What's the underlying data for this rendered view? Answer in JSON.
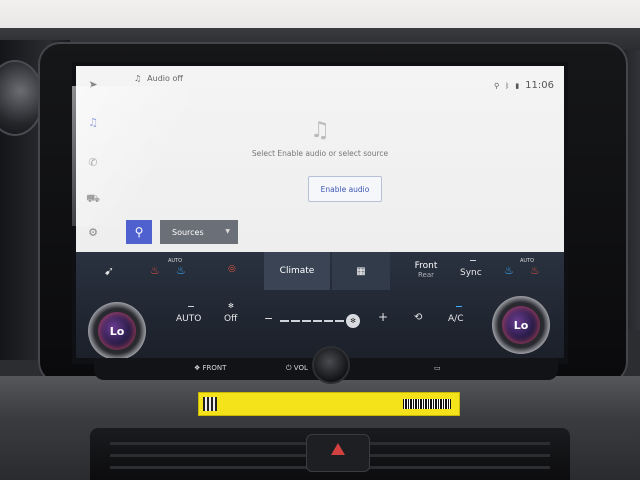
{
  "status": {
    "audio_label": "Audio off",
    "time": "11:06"
  },
  "side_nav": [
    "navigation-icon",
    "music-icon",
    "phone-icon",
    "car-icon",
    "settings-icon"
  ],
  "audio": {
    "message": "Select Enable audio or select source",
    "enable_button": "Enable audio",
    "sources_label": "Sources"
  },
  "climate": {
    "auto_tag_left": "AUTO",
    "auto_tag_right": "AUTO",
    "climate_tab": "Climate",
    "front_label": "Front",
    "rear_label": "Rear",
    "sync_label": "Sync",
    "auto_label": "AUTO",
    "fan_off_label": "Off",
    "minus_label": "−",
    "plus_label": "+",
    "ac_label": "A/C",
    "left_temp": "Lo",
    "right_temp": "Lo",
    "fan_level": 0
  },
  "bottom_strip": {
    "front_defrost": "FRONT",
    "vol": "VOL"
  },
  "colors": {
    "accent": "#4f61cf",
    "climate_bg": "#1b2029",
    "ac_indicator": "#3ab0ff",
    "seat_heat": "#e0533c"
  }
}
